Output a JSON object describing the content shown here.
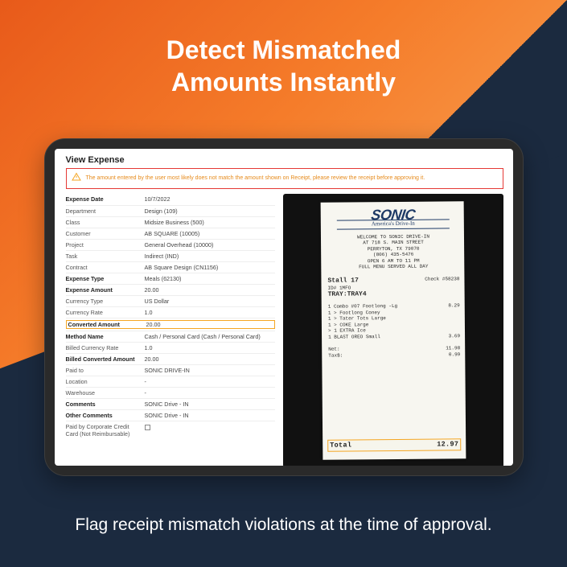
{
  "headline_line1": "Detect Mismatched",
  "headline_line2": "Amounts Instantly",
  "footer": "Flag receipt mismatch violations at the time of approval.",
  "expense": {
    "title": "View Expense",
    "warning": "The amount entered by the user most likely does not match the amount shown on Receipt, please review the receipt before approving it.",
    "rows": [
      {
        "label": "Expense Date",
        "value": "10/7/2022",
        "bold": true
      },
      {
        "label": "Department",
        "value": "Design (109)"
      },
      {
        "label": "Class",
        "value": "Midsize Business (500)"
      },
      {
        "label": "Customer",
        "value": "AB SQUARE (10005)"
      },
      {
        "label": "Project",
        "value": "General Overhead (10000)"
      },
      {
        "label": "Task",
        "value": "Indirect (IND)"
      },
      {
        "label": "Contract",
        "value": "AB Square Design (CN1156)"
      },
      {
        "label": "Expense Type",
        "value": "Meals (62130)",
        "bold": true
      },
      {
        "label": "Expense Amount",
        "value": "20.00",
        "bold": true
      },
      {
        "label": "Currency Type",
        "value": "US Dollar"
      },
      {
        "label": "Currency Rate",
        "value": "1.0"
      },
      {
        "label": "Converted Amount",
        "value": "20.00",
        "bold": true,
        "hl": true
      },
      {
        "label": "Method Name",
        "value": "Cash / Personal Card (Cash / Personal Card)",
        "bold": true
      },
      {
        "label": "Billed Currency Rate",
        "value": "1.0"
      },
      {
        "label": "Billed Converted Amount",
        "value": "20.00",
        "bold": true
      },
      {
        "label": "Paid to",
        "value": "SONIC DRIVE-IN"
      },
      {
        "label": "Location",
        "value": "-"
      },
      {
        "label": "Warehouse",
        "value": "-"
      },
      {
        "label": "Comments",
        "value": "SONIC Drive - IN",
        "bold": true
      },
      {
        "label": "Other Comments",
        "value": "SONIC Drive - IN",
        "bold": true
      },
      {
        "label": "Paid by Corporate Credit Card (Not Reimbursable)",
        "value": "__checkbox__"
      }
    ]
  },
  "receipt": {
    "logo": "SONIC",
    "logo_sub": "America's Drive-In",
    "addr1": "WELCOME TO SONIC DRIVE-IN",
    "addr2": "AT 718 S. MAIN STREET",
    "addr3": "PERRYTON, TX  79070",
    "addr4": "(806) 435-5476",
    "addr5": "OPEN 6 AM TO 11 PM",
    "addr6": "FULL MENU SERVED ALL DAY",
    "stall_line_left": "Stall  17",
    "stall_line_right": "Check #58238",
    "id_line": "ID#  1MFO",
    "tray_line": "TRAY:TRAY4",
    "items": [
      {
        "name": "1 Combo #07 Footlong -Lg",
        "price": "8.29"
      },
      {
        "name": "1 > Footlong Coney",
        "price": ""
      },
      {
        "name": "1 > Tater Tots Large",
        "price": ""
      },
      {
        "name": "1 > COKE Large",
        "price": ""
      },
      {
        "name": "  > 1 EXTRA Ice",
        "price": ""
      },
      {
        "name": "1 BLAST OREO Small",
        "price": "3.69"
      }
    ],
    "net_label": "Net:",
    "net_value": "11.98",
    "tax_label": "Tax$:",
    "tax_value": "0.99",
    "total_label": "Total",
    "total_value": "12.97"
  }
}
